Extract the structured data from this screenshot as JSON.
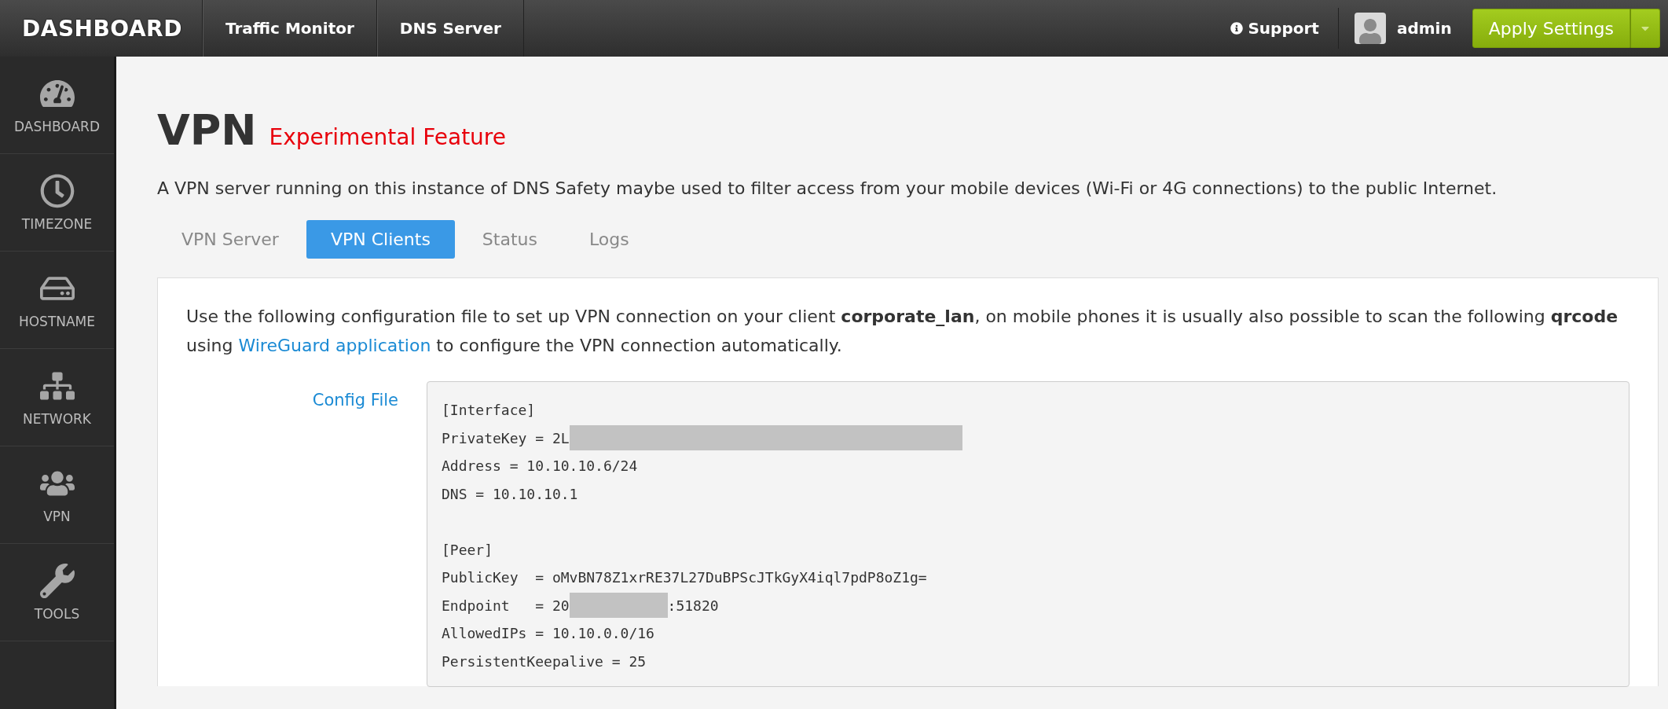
{
  "topbar": {
    "brand": "DASHBOARD",
    "nav": [
      {
        "label": "Traffic Monitor"
      },
      {
        "label": "DNS Server"
      }
    ],
    "support": "Support",
    "user": "admin",
    "apply_button": "Apply Settings"
  },
  "sidebar": {
    "items": [
      {
        "label": "DASHBOARD",
        "kind": "gauge",
        "selected": false
      },
      {
        "label": "TIMEZONE",
        "kind": "clock",
        "selected": false
      },
      {
        "label": "HOSTNAME",
        "kind": "drive",
        "selected": false
      },
      {
        "label": "NETWORK",
        "kind": "network",
        "selected": false
      },
      {
        "label": "VPN",
        "kind": "users",
        "selected": false
      },
      {
        "label": "TOOLS",
        "kind": "wrench",
        "selected": false
      }
    ]
  },
  "page": {
    "title": "VPN",
    "badge": "Experimental Feature",
    "description": "A VPN server running on this instance of DNS Safety maybe used to filter access from your mobile devices (Wi-Fi or 4G connections) to the public Internet.",
    "tabs": [
      {
        "label": "VPN Server",
        "selected": false
      },
      {
        "label": "VPN Clients",
        "selected": true
      },
      {
        "label": "Status",
        "selected": false
      },
      {
        "label": "Logs",
        "selected": false
      }
    ],
    "panel": {
      "intro": "Use the following configuration file to set up VPN connection on your client **corporate_lan**, on mobile phones it is usually also possible to scan the following **qrcode** using",
      "link": "WireGuard application",
      "intro_end": "to configure the VPN connection automatically.",
      "config_label": "Config File",
      "config_lines": [
        {
          "kind": "text",
          "segments": [
            {
              "kind": "text",
              "text": "[Interface]"
            }
          ]
        },
        {
          "kind": "text",
          "segments": [
            {
              "kind": "text",
              "text": "PrivateKey = 2L"
            },
            {
              "kind": "redaction"
            }
          ]
        },
        {
          "kind": "text",
          "segments": [
            {
              "kind": "text",
              "text": "Address = 10.10.10.6/24"
            }
          ]
        },
        {
          "kind": "text",
          "segments": [
            {
              "kind": "text",
              "text": "DNS = 10.10.10.1"
            }
          ]
        },
        {
          "kind": "blank"
        },
        {
          "kind": "text",
          "segments": [
            {
              "kind": "text",
              "text": "[Peer]"
            }
          ]
        },
        {
          "kind": "text",
          "segments": [
            {
              "kind": "text",
              "text": "PublicKey  = oMvBN78Z1xrRE37L27DuBPScJTkGyX4iql7pdP8oZ1g="
            }
          ]
        },
        {
          "kind": "text",
          "segments": [
            {
              "kind": "text",
              "text": "Endpoint   = 20"
            },
            {
              "kind": "redaction"
            },
            {
              "kind": "text",
              "text": ":51820"
            }
          ]
        },
        {
          "kind": "text",
          "segments": [
            {
              "kind": "text",
              "text": "AllowedIPs = 10.10.0.0/16"
            }
          ]
        },
        {
          "kind": "text",
          "segments": [
            {
              "kind": "text",
              "text": "PersistentKeepalive = 25"
            }
          ]
        }
      ]
    }
  }
}
